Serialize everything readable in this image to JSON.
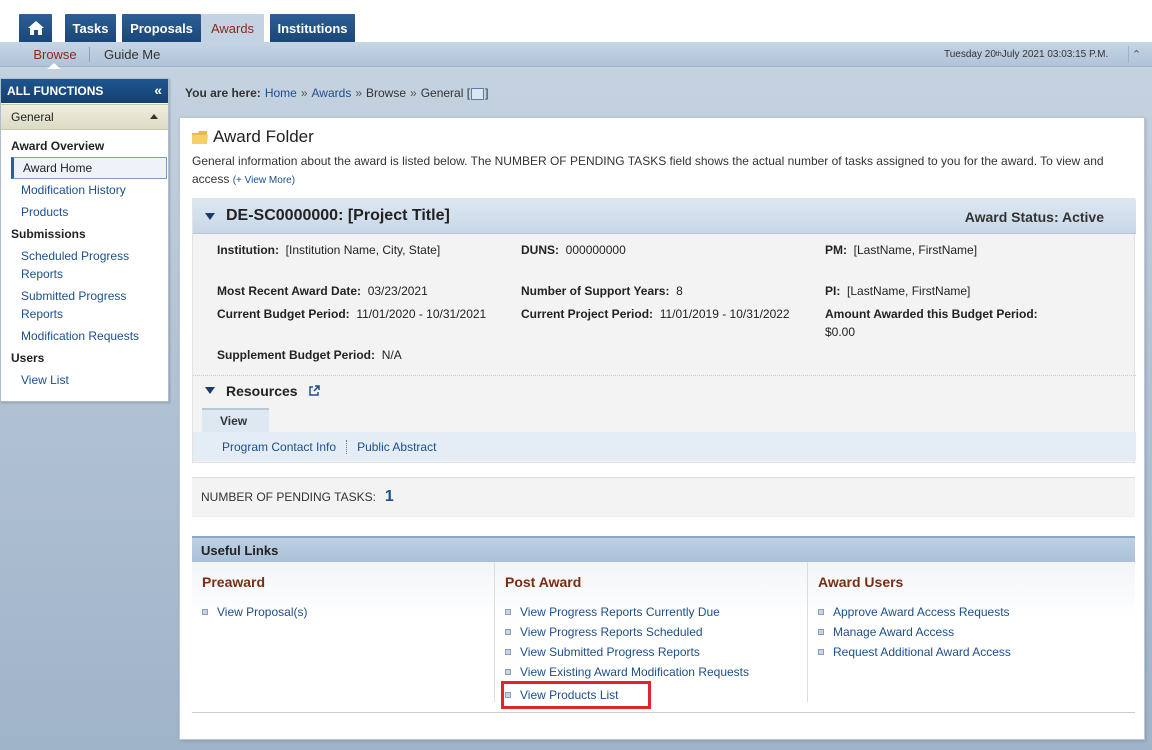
{
  "nav": {
    "tabs": [
      {
        "label": "Tasks"
      },
      {
        "label": "Proposals"
      },
      {
        "label": "Awards"
      },
      {
        "label": "Institutions"
      }
    ]
  },
  "subnav": {
    "browse": "Browse",
    "guide": "Guide Me",
    "datetime_prefix": "Tuesday 20",
    "datetime_sup": "th",
    "datetime_suffix": " July 2021 03:03:15 P.M."
  },
  "sidebar": {
    "header": "ALL FUNCTIONS",
    "section": "General",
    "groups": [
      {
        "title": "Award Overview",
        "items": [
          "Award Home",
          "Modification History",
          "Products"
        ]
      },
      {
        "title": "Submissions",
        "items": [
          "Scheduled Progress Reports",
          "Submitted Progress Reports",
          "Modification Requests"
        ]
      },
      {
        "title": "Users",
        "items": [
          "View List"
        ]
      }
    ]
  },
  "breadcrumb": {
    "label": "You are here:",
    "items": [
      "Home",
      "Awards",
      "Browse",
      "General ["
    ],
    "end": "]",
    "sep": "»"
  },
  "main": {
    "title": "Award Folder",
    "intro": "General information about the award is listed below. The NUMBER OF PENDING TASKS field shows the actual number of tasks assigned to you for the award. To view and access",
    "view_more": "(+ View More)",
    "award_id": "DE-SC0000000: [Project Title]",
    "status": "Award Status: Active",
    "fields": {
      "institution_k": "Institution:",
      "institution_v": "[Institution Name, City, State]",
      "duns_k": "DUNS:",
      "duns_v": "000000000",
      "pm_k": "PM:",
      "pm_v": "[LastName, FirstName]",
      "recent_k": "Most Recent Award Date:",
      "recent_v": "03/23/2021",
      "years_k": "Number of Support Years:",
      "years_v": "8",
      "pi_k": "PI:",
      "pi_v": "[LastName, FirstName]",
      "budget_k": "Current Budget Period:",
      "budget_v": "11/01/2020 - 10/31/2021",
      "project_k": "Current Project Period:",
      "project_v": "11/01/2019 - 10/31/2022",
      "amount_k": "Amount Awarded this Budget Period:",
      "amount_v": "$0.00",
      "supp_k": "Supplement Budget Period:",
      "supp_v": "N/A"
    },
    "resources": {
      "title": "Resources",
      "tab": "View",
      "links": [
        "Program Contact Info",
        "Public Abstract"
      ]
    },
    "pending": {
      "label": "NUMBER OF PENDING TASKS:",
      "value": "1"
    },
    "useful": {
      "title": "Useful Links",
      "columns": [
        {
          "title": "Preaward",
          "links": [
            "View Proposal(s)"
          ]
        },
        {
          "title": "Post Award",
          "links": [
            "View Progress Reports Currently Due",
            "View Progress Reports Scheduled",
            "View Submitted Progress Reports",
            "View Existing Award Modification Requests",
            "View Products List"
          ]
        },
        {
          "title": "Award Users",
          "links": [
            "Approve Award Access Requests",
            "Manage Award Access",
            "Request Additional Award Access"
          ]
        }
      ]
    }
  }
}
